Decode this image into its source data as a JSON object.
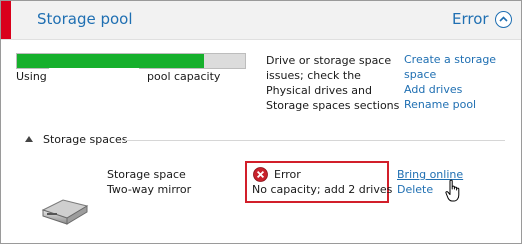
{
  "header": {
    "title": "Storage pool",
    "status": "Error",
    "accent_color": "#1f6fb2",
    "alert_color": "#d9001b"
  },
  "capacity": {
    "using_label": "Using",
    "pool_capacity_label": "pool capacity",
    "used_fraction": 0.82,
    "fill_color": "#16b02c"
  },
  "issue": {
    "message": "Drive or storage space issues; check the Physical drives and Storage spaces sections"
  },
  "actions": {
    "create_line1": "Create a storage",
    "create_line2": "space",
    "add_drives": "Add drives",
    "rename_pool": "Rename pool"
  },
  "spaces": {
    "header": "Storage spaces",
    "item": {
      "name": "Storage space",
      "type": "Two-way mirror",
      "icon": "disk-drive-icon",
      "status_title": "Error",
      "status_detail": "No capacity; add 2 drives",
      "bring_online": "Bring online",
      "delete": "Delete"
    }
  }
}
